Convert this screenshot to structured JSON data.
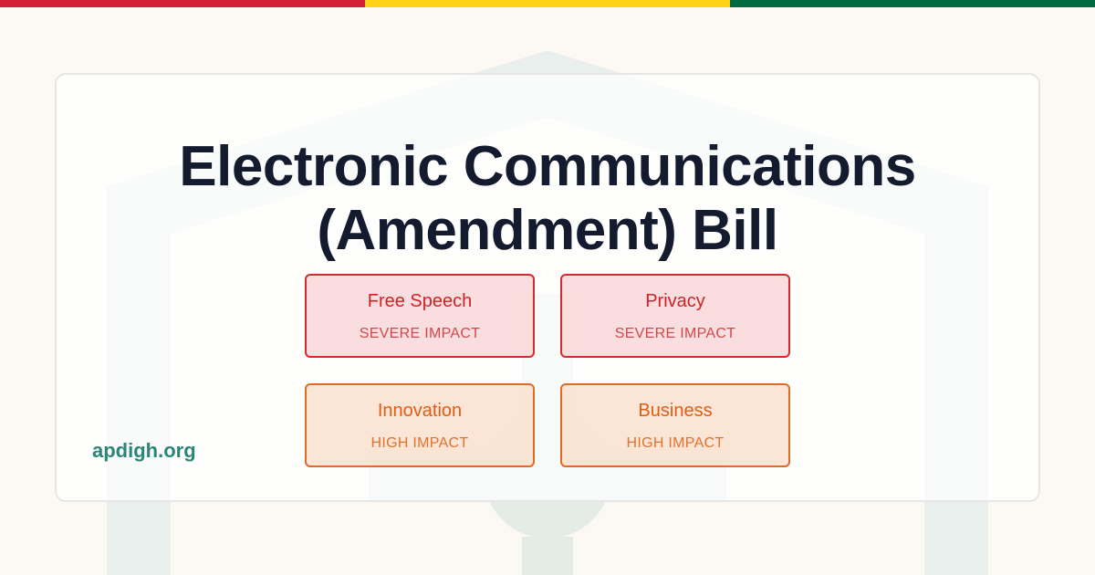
{
  "brand_colors": {
    "flag_red": "#d21f34",
    "flag_yellow": "#fed116",
    "flag_green": "#006a3f",
    "severe_accent": "#d42a30",
    "high_accent": "#e06a26",
    "link_accent": "#2c8579"
  },
  "watermark_icon": "house-with-person-icon",
  "title": {
    "line1": "Electronic Communications",
    "line2": "(Amendment) Bill"
  },
  "impacts": [
    {
      "label": "Free Speech",
      "level": "SEVERE IMPACT",
      "severity": "severe"
    },
    {
      "label": "Privacy",
      "level": "SEVERE IMPACT",
      "severity": "severe"
    },
    {
      "label": "Innovation",
      "level": "HIGH IMPACT",
      "severity": "high"
    },
    {
      "label": "Business",
      "level": "HIGH IMPACT",
      "severity": "high"
    }
  ],
  "site": {
    "label": "apdigh.org"
  }
}
